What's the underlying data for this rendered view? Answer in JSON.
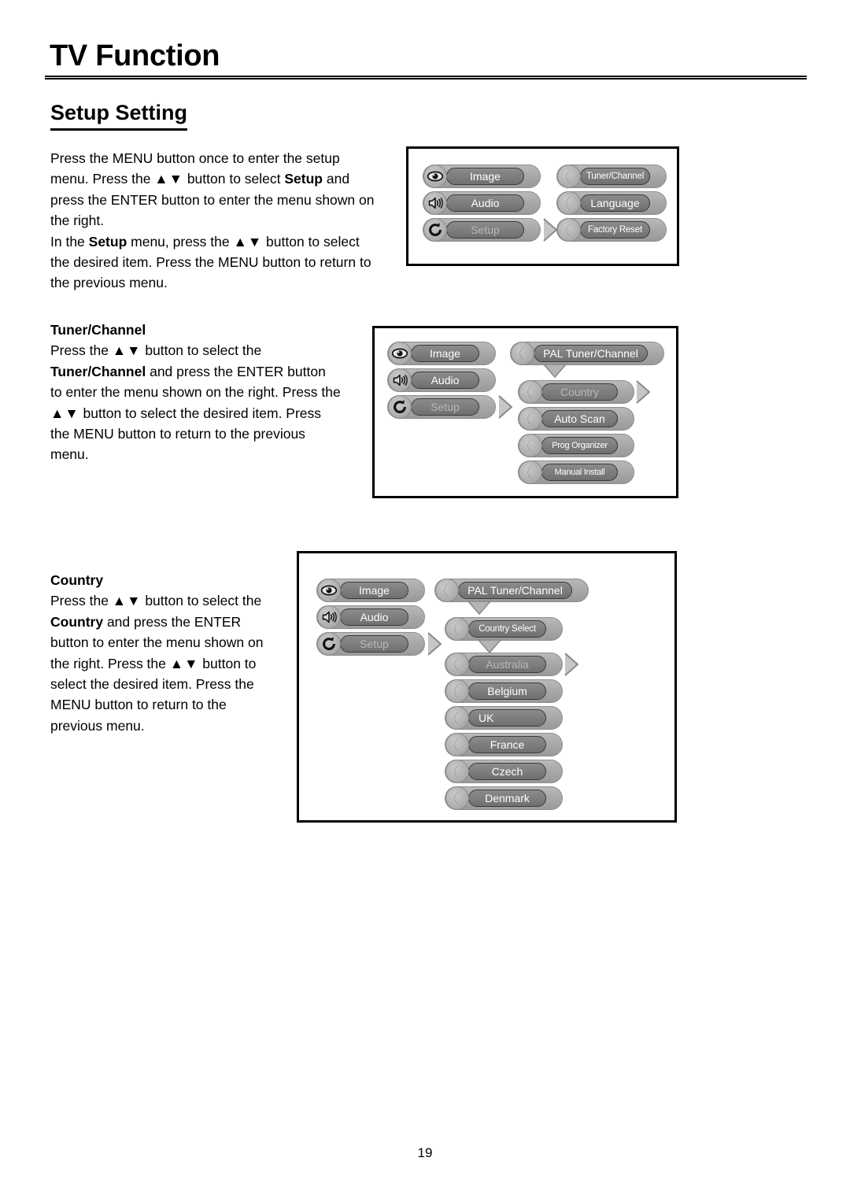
{
  "header": {
    "title": "TV Function",
    "section": "Setup Setting"
  },
  "body": {
    "setup_paragraph": {
      "line1": "Press the MENU button once to enter the setup",
      "line2_a": "menu. Press the ",
      "line2_arrows": "▲▼",
      "line2_b": " button to select ",
      "line2_bold": "Setup",
      "line2_c": " and",
      "line3": "press the ENTER button to enter the menu shown on",
      "line4": "the right.",
      "line5_a": "In the ",
      "line5_bold": "Setup",
      "line5_b": " menu, press the ",
      "line5_arrows": "▲▼",
      "line5_c": " button to select",
      "line6": "the desired item. Press the MENU button to return to",
      "line7": "the previous menu."
    },
    "tuner_paragraph": {
      "heading": "Tuner/Channel",
      "line1_a": "Press the ",
      "line1_arrows": "▲▼",
      "line1_b": " button to select the",
      "line2_bold": "Tuner/Channel",
      "line2_a": " and press the ENTER button",
      "line3": "to enter the menu shown on the right. Press the",
      "line4_arrows": "▲▼",
      "line4_a": " button to select the desired item. Press",
      "line5": "the MENU button to return to the previous",
      "line6": "menu."
    },
    "country_paragraph": {
      "heading": "Country",
      "line1_a": "Press the ",
      "line1_arrows": "▲▼",
      "line1_b": " button to select the",
      "line2_bold": "Country",
      "line2_a": " and press the ENTER",
      "line3": "button to enter the menu shown on",
      "line4_a": "the right. Press the ",
      "line4_arrows": "▲▼",
      "line4_b": " button to",
      "line5": "select the desired item. Press the",
      "line6": "MENU button to return to the",
      "line7": "previous menu."
    }
  },
  "diagrams": {
    "setup": {
      "left_column": [
        {
          "label": "Image",
          "icon": "eye-icon",
          "selected": false
        },
        {
          "label": "Audio",
          "icon": "speaker-icon",
          "selected": false
        },
        {
          "label": "Setup",
          "icon": "refresh-icon",
          "selected": true
        }
      ],
      "right_column": [
        {
          "label": "Tuner/Channel",
          "icon": "moon-icon",
          "selected": false
        },
        {
          "label": "Language",
          "icon": "moon-icon",
          "selected": false
        },
        {
          "label": "Factory Reset",
          "icon": "moon-icon",
          "selected": false
        }
      ]
    },
    "tuner": {
      "left_column": [
        {
          "label": "Image",
          "icon": "eye-icon",
          "selected": false
        },
        {
          "label": "Audio",
          "icon": "speaker-icon",
          "selected": false
        },
        {
          "label": "Setup",
          "icon": "refresh-icon",
          "selected": true
        }
      ],
      "parent": {
        "label": "PAL Tuner/Channel",
        "icon": "moon-icon"
      },
      "items": [
        {
          "label": "Country",
          "icon": "moon-icon",
          "selected": true
        },
        {
          "label": "Auto Scan",
          "icon": "moon-icon",
          "selected": false
        },
        {
          "label": "Prog Organizer",
          "icon": "moon-icon",
          "selected": false
        },
        {
          "label": "Manual Install",
          "icon": "moon-icon",
          "selected": false
        }
      ]
    },
    "country": {
      "left_column": [
        {
          "label": "Image",
          "icon": "eye-icon",
          "selected": false
        },
        {
          "label": "Audio",
          "icon": "speaker-icon",
          "selected": false
        },
        {
          "label": "Setup",
          "icon": "refresh-icon",
          "selected": true
        }
      ],
      "parent": {
        "label": "PAL Tuner/Channel",
        "icon": "moon-icon"
      },
      "submenu": {
        "label": "Country Select",
        "icon": "moon-icon"
      },
      "items": [
        {
          "label": "Australia",
          "icon": "moon-icon",
          "selected": true
        },
        {
          "label": "Belgium",
          "icon": "moon-icon",
          "selected": false
        },
        {
          "label": "UK",
          "icon": "moon-icon",
          "selected": false
        },
        {
          "label": "France",
          "icon": "moon-icon",
          "selected": false
        },
        {
          "label": "Czech",
          "icon": "moon-icon",
          "selected": false
        },
        {
          "label": "Denmark",
          "icon": "moon-icon",
          "selected": false
        }
      ]
    }
  },
  "footer": {
    "page_number": "19"
  },
  "colors": {
    "capsule": "#a6a6a6",
    "plate": "#7e7e7e",
    "plate_border": "#3a3a3a",
    "text_on_plate": "#ffffff",
    "text_on_plate_dim": "#b9b9b9",
    "frame_border": "#000000",
    "page_background": "#ffffff"
  }
}
